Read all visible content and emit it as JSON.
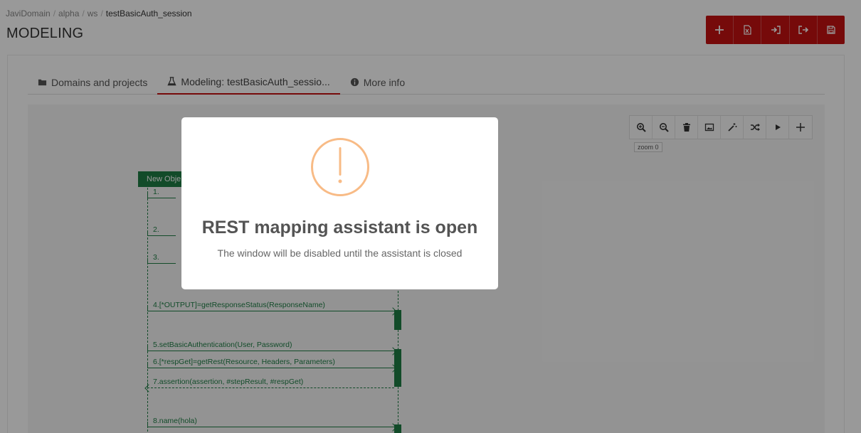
{
  "breadcrumb": [
    "JaviDomain",
    "alpha",
    "ws",
    "testBasicAuth_session"
  ],
  "page_title": "MODELING",
  "top_actions": [
    {
      "icon": "plus-icon"
    },
    {
      "icon": "excel-file-icon"
    },
    {
      "icon": "sign-in-icon"
    },
    {
      "icon": "sign-out-icon"
    },
    {
      "icon": "save-icon"
    }
  ],
  "tabs": [
    {
      "label": "Domains and projects",
      "icon": "folder-icon"
    },
    {
      "label": "Modeling: testBasicAuth_sessio...",
      "icon": "flask-icon"
    },
    {
      "label": "More info",
      "icon": "info-circle-icon"
    }
  ],
  "diagram_toolbar": [
    {
      "icon": "zoom-in-icon"
    },
    {
      "icon": "zoom-out-icon"
    },
    {
      "icon": "trash-icon"
    },
    {
      "icon": "image-icon"
    },
    {
      "icon": "magic-wand-icon"
    },
    {
      "icon": "shuffle-icon"
    },
    {
      "icon": "play-icon"
    },
    {
      "icon": "plus-icon"
    }
  ],
  "zoom_label": "zoom 0",
  "diagram": {
    "object_label": "New Obje",
    "messages": [
      {
        "label": "1."
      },
      {
        "label": "2."
      },
      {
        "label": "3."
      },
      {
        "label": "4.[*OUTPUT]=getResponseStatus(ResponseName)"
      },
      {
        "label": "5.setBasicAuthentication(User, Password)"
      },
      {
        "label": "6.[*respGet]=getRest(Resource, Headers, Parameters)"
      },
      {
        "label": "7.assertion(assertion, #stepResult, #respGet)"
      },
      {
        "label": "8.name(hola)"
      }
    ]
  },
  "modal": {
    "title": "REST mapping assistant is open",
    "subtitle": "The window will be disabled until the assistant is closed",
    "icon": "warning-icon",
    "accent": "#f8bb86"
  },
  "colors": {
    "brand_red": "#c51212",
    "diagram_green": "#1e7e45"
  }
}
